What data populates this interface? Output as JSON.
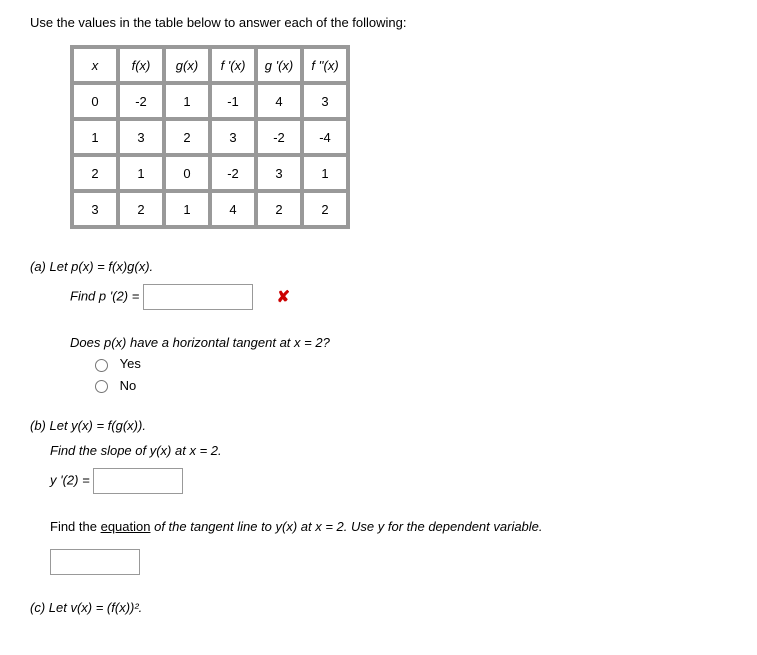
{
  "intro": "Use the values in the table below to answer each of the following:",
  "table": {
    "headers": [
      "x",
      "f(x)",
      "g(x)",
      "f '(x)",
      "g '(x)",
      "f ''(x)"
    ],
    "rows": [
      [
        "0",
        "-2",
        "1",
        "-1",
        "4",
        "3"
      ],
      [
        "1",
        "3",
        "2",
        "3",
        "-2",
        "-4"
      ],
      [
        "2",
        "1",
        "0",
        "-2",
        "3",
        "1"
      ],
      [
        "3",
        "2",
        "1",
        "4",
        "2",
        "2"
      ]
    ]
  },
  "partA": {
    "label": "(a) Let p(x) = f(x)g(x).",
    "findLabel": "Find p '(2) = ",
    "answer": "",
    "xmark": "✘",
    "tangentQ": "Does p(x) have a horizontal tangent at x = 2?",
    "yes": "Yes",
    "no": "No"
  },
  "partB": {
    "label": "(b) Let y(x) = f(g(x)).",
    "slopeText": "Find the slope of y(x) at x = 2.",
    "yprime": "y '(2) = ",
    "slopeAnswer": "",
    "equationPrefix": "Find the ",
    "equationWord": "equation",
    "equationSuffix": " of the tangent line to y(x) at x = 2. Use y for the dependent variable.",
    "eqAnswer": ""
  },
  "partC": {
    "label": "(c) Let v(x) = (f(x))²."
  }
}
